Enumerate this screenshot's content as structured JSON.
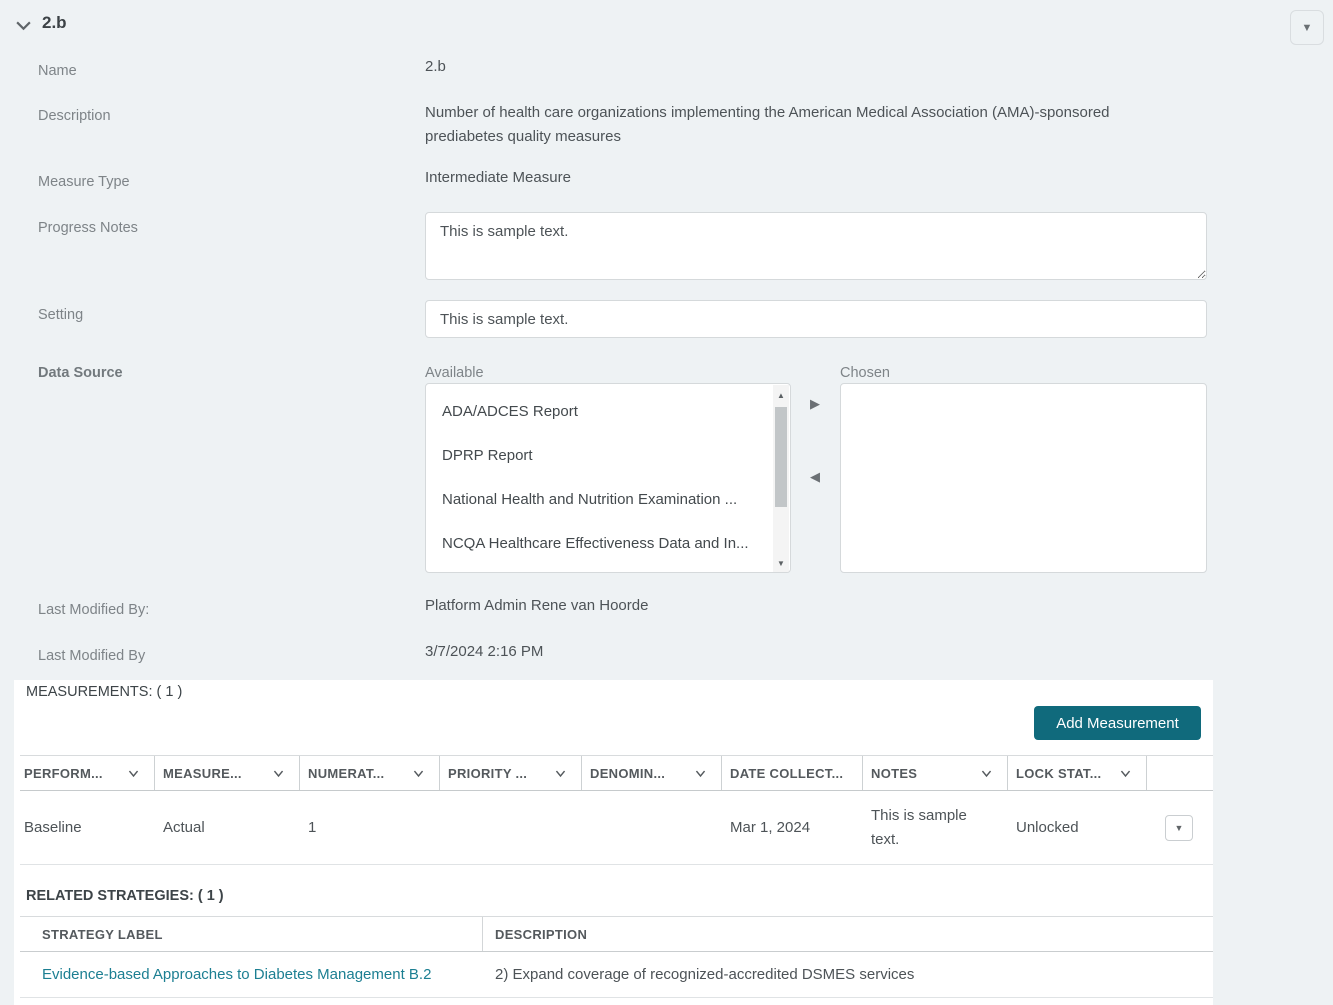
{
  "header": {
    "title": "2.b"
  },
  "icons": {
    "caret_down": "▼",
    "scroll_up": "▲",
    "scroll_down": "▼",
    "move_right": "▶",
    "move_left": "◀"
  },
  "form": {
    "name": {
      "label": "Name",
      "value": "2.b"
    },
    "description": {
      "label": "Description",
      "value": "Number of health care organizations implementing the American Medical Association (AMA)-sponsored prediabetes quality measures"
    },
    "measure_type": {
      "label": "Measure Type",
      "value": "Intermediate Measure"
    },
    "progress_notes": {
      "label": "Progress Notes",
      "value": "This is sample text."
    },
    "setting": {
      "label": "Setting",
      "value": "This is sample text."
    },
    "data_source": {
      "label": "Data Source",
      "available_label": "Available",
      "chosen_label": "Chosen",
      "available_items": [
        "ADA/ADCES Report",
        "DPRP Report",
        "National Health and Nutrition Examination ...",
        "NCQA Healthcare Effectiveness Data and In..."
      ],
      "chosen_items": []
    },
    "last_modified_by": {
      "label": "Last Modified By:",
      "value": "Platform Admin Rene van Hoorde"
    },
    "last_modified_date": {
      "label": "Last Modified By",
      "value": "3/7/2024 2:16 PM"
    }
  },
  "measurements": {
    "heading": "MEASUREMENTS: ( 1 )",
    "add_button": "Add Measurement",
    "columns": [
      "PERFORM...",
      "MEASURE...",
      "NUMERAT...",
      "PRIORITY ...",
      "DENOMIN...",
      "DATE COLLECT...",
      "NOTES",
      "LOCK STAT..."
    ],
    "rows": [
      {
        "performance": "Baseline",
        "measure": "Actual",
        "numerator": "1",
        "priority": "",
        "denominator": "",
        "date_collected": "Mar 1, 2024",
        "notes": "This is sample text.",
        "lock_status": "Unlocked"
      }
    ]
  },
  "related": {
    "heading": "RELATED STRATEGIES: ( 1 )",
    "columns": [
      "STRATEGY LABEL",
      "DESCRIPTION"
    ],
    "rows": [
      {
        "label": "Evidence-based Approaches to Diabetes Management B.2",
        "description": "2) Expand coverage of recognized-accredited DSMES services"
      }
    ]
  },
  "colors": {
    "accent_teal": "#106a7c",
    "link_teal": "#1c7f92",
    "page_background": "#eef2f4"
  }
}
